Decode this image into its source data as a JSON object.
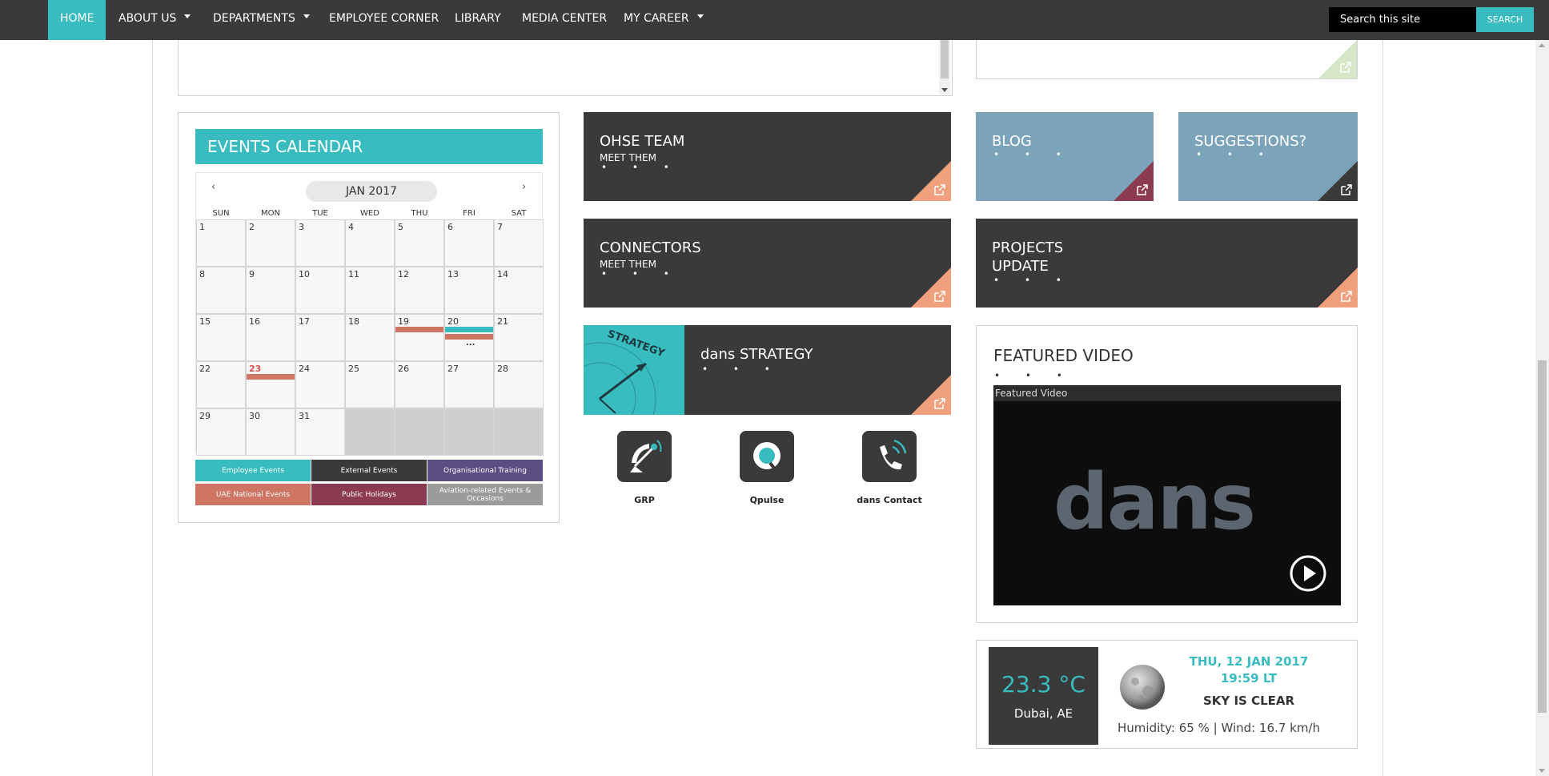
{
  "nav": {
    "items": [
      {
        "label": "HOME",
        "dropdown": false
      },
      {
        "label": "ABOUT US",
        "dropdown": true
      },
      {
        "label": "DEPARTMENTS",
        "dropdown": true
      },
      {
        "label": "EMPLOYEE CORNER",
        "dropdown": false
      },
      {
        "label": "LIBRARY",
        "dropdown": false
      },
      {
        "label": "MEDIA CENTER",
        "dropdown": false
      },
      {
        "label": "MY CAREER",
        "dropdown": true
      }
    ],
    "search_placeholder": "Search this site",
    "search_label": "SEARCH"
  },
  "calendar": {
    "title": "EVENTS CALENDAR",
    "month": "JAN 2017",
    "prev": "‹",
    "next": "›",
    "weekdays": [
      "SUN",
      "MON",
      "TUE",
      "WED",
      "THU",
      "FRI",
      "SAT"
    ],
    "days": [
      "1",
      "2",
      "3",
      "4",
      "5",
      "6",
      "7",
      "8",
      "9",
      "10",
      "11",
      "12",
      "13",
      "14",
      "15",
      "16",
      "17",
      "18",
      "19",
      "20",
      "21",
      "22",
      "23",
      "24",
      "25",
      "26",
      "27",
      "28",
      "29",
      "30",
      "31"
    ],
    "today": "23",
    "more": "...",
    "legend": [
      {
        "label": "Employee Events",
        "color": "#38bcbf"
      },
      {
        "label": "External Events",
        "color": "#3a3a3a"
      },
      {
        "label": "Organisational Training",
        "color": "#5a4e82"
      },
      {
        "label": "UAE National Events",
        "color": "#cf7563"
      },
      {
        "label": "Public Holidays",
        "color": "#8b3a52"
      },
      {
        "label": "Aviation-related Events & Occasions",
        "color": "#9b9b9b"
      }
    ]
  },
  "tiles": {
    "ohse": {
      "title": "OHSE TEAM",
      "sub": "MEET THEM",
      "dots": "• • •"
    },
    "connectors": {
      "title": "CONNECTORS",
      "sub": "MEET THEM",
      "dots": "• • •"
    },
    "strategy": {
      "title": "dans STRATEGY",
      "dots": "• • •",
      "image_text": "STRATEGY"
    },
    "blog": {
      "title": "BLOG",
      "dots": "• • •"
    },
    "suggestions": {
      "title": "SUGGESTIONS?",
      "dots": "• • •"
    },
    "projects": {
      "title_line1": "PROJECTS",
      "title_line2": "UPDATE",
      "dots": "• • •"
    }
  },
  "apps": [
    {
      "label": "GRP",
      "icon": "satellite-dish-icon"
    },
    {
      "label": "Qpulse",
      "icon": "qpulse-icon"
    },
    {
      "label": "dans Contact",
      "icon": "phone-icon"
    }
  ],
  "video": {
    "title": "FEATURED VIDEO",
    "dots": "• • •",
    "bar_label": "Featured Video",
    "logo_text": "dans"
  },
  "weather": {
    "temperature": "23.3 °C",
    "city": "Dubai, AE",
    "date": "THU, 12 JAN 2017",
    "time": "19:59 LT",
    "sky": "SKY IS CLEAR",
    "humidity_line": "Humidity:  65 % | Wind:  16.7 km/h"
  },
  "colors": {
    "accent": "#38bcbf",
    "dark": "#3a3a3a",
    "blue_tile": "#7ba3ba",
    "orange_corner": "#f0a07c",
    "maroon_corner": "#8b3a52"
  }
}
